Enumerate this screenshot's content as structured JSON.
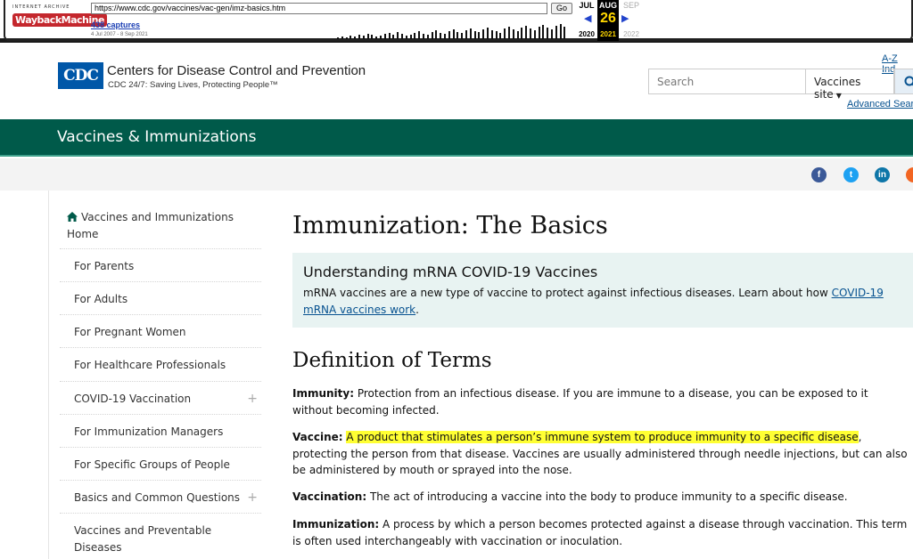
{
  "wayback": {
    "logo_top": "INTERNET ARCHIVE",
    "logo_main": "WaybackMachine",
    "url": "https://www.cdc.gov/vaccines/vac-gen/imz-basics.htm",
    "go_label": "Go",
    "captures": "438 captures",
    "range": "4 Jul 2007 - 8 Sep 2021",
    "months": [
      "JUL",
      "AUG",
      "SEP"
    ],
    "day": "26",
    "years": [
      "2020",
      "2021",
      "2022"
    ]
  },
  "header": {
    "logo_text": "CDC",
    "org_name": "Centers for Disease Control and Prevention",
    "tagline": "CDC 24/7: Saving Lives, Protecting People™",
    "az_link": "A-Z Ind",
    "search_placeholder": "Search",
    "search_scope": "Vaccines site",
    "advanced_search": "Advanced Sear"
  },
  "banner": {
    "title": "Vaccines & Immunizations"
  },
  "social": [
    "f",
    "t",
    "in",
    "rss"
  ],
  "sidebar": {
    "home": "Vaccines and Immunizations Home",
    "items": [
      {
        "label": "For Parents",
        "expandable": false
      },
      {
        "label": "For Adults",
        "expandable": false
      },
      {
        "label": "For Pregnant Women",
        "expandable": false
      },
      {
        "label": "For Healthcare Professionals",
        "expandable": false
      },
      {
        "label": "COVID-19 Vaccination",
        "expandable": true
      },
      {
        "label": "For Immunization Managers",
        "expandable": false
      },
      {
        "label": "For Specific Groups of People",
        "expandable": false
      },
      {
        "label": "Basics and Common Questions",
        "expandable": true
      },
      {
        "label": "Vaccines and Preventable Diseases",
        "expandable": false
      }
    ]
  },
  "main": {
    "title": "Immunization: The Basics",
    "callout": {
      "title": "Understanding mRNA COVID-19 Vaccines",
      "body": "mRNA vaccines are a new type of vaccine to protect against infectious diseases. Learn about how ",
      "link": "COVID-19 mRNA vaccines work",
      "end": "."
    },
    "definitions_heading": "Definition of Terms",
    "terms": [
      {
        "term": "Immunity:",
        "pre": "",
        "highlight": "",
        "text": " Protection from an infectious disease. If you are immune to a disease, you can be exposed to it without becoming infected."
      },
      {
        "term": "Vaccine:",
        "pre": " ",
        "highlight": "A product that stimulates a person’s immune system to produce immunity to a specific disease",
        "text": ", protecting the person from that disease. Vaccines are usually administered through needle injections, but can also be administered by mouth or sprayed into the nose."
      },
      {
        "term": "Vaccination:",
        "pre": "",
        "highlight": "",
        "text": " The act of introducing a vaccine into the body to produce immunity to a specific disease."
      },
      {
        "term": "Immunization:",
        "pre": "",
        "highlight": "",
        "text": " A process by which a person becomes protected against a disease through vaccination. This term is often used interchangeably with vaccination or inoculation."
      }
    ]
  },
  "colors": {
    "banner": "#005a4a",
    "link": "#075290",
    "callout_bg": "#e8f3f2",
    "highlight": "#ffff33",
    "cdc_blue": "#0057a8"
  }
}
